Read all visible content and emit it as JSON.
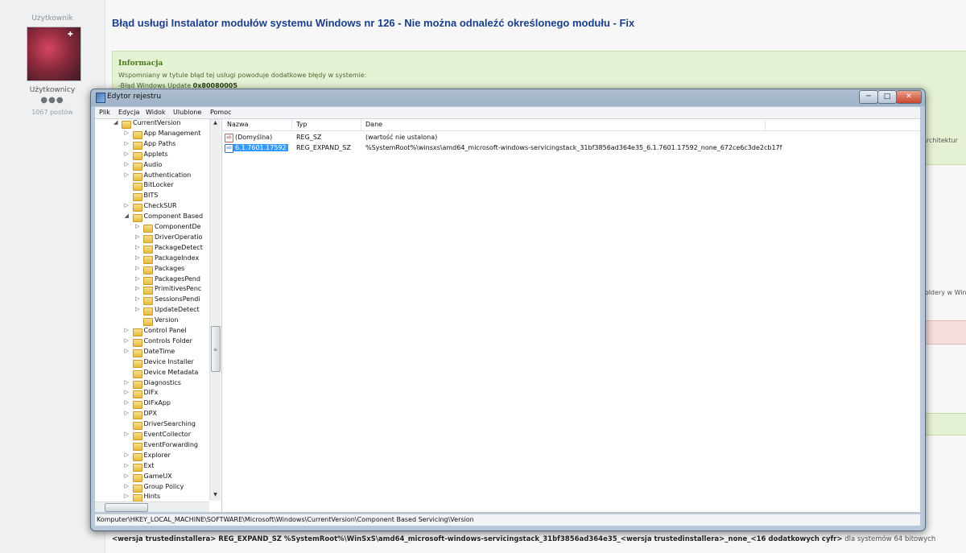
{
  "forum": {
    "sidebar": {
      "role_top": "Użytkownik",
      "username": "Użytkownicy",
      "rank_dots": "●●●",
      "post_count": "1067 postów"
    },
    "title": "Błąd usługi Instalator modułów systemu Windows nr 126 - Nie można odnaleźć określonego modułu - Fix",
    "info": {
      "heading": "Informacja",
      "text": "Wspomniany w tytule błąd tej usługi powoduje dodatkowe błędy w systemie:",
      "item_prefix": "-Błąd Windows Update ",
      "item_code": "0x80080005"
    },
    "snippets": {
      "right_1": "architektur",
      "right_2": "foldery w Win"
    },
    "bottom_line": {
      "part1": "<wersja trustedinstallera> REG_EXPAND_SZ %SystemRoot%\\WinSxS\\amd64_microsoft-windows-servicingstack_31bf3856ad364e35_<wersja trustedinstallera>_none_<16 dodatkowych cyfr>",
      "part2": " dla systemów 64 bitowych"
    }
  },
  "regedit": {
    "title": "Edytor rejestru",
    "buttons": {
      "minimize": "─",
      "maximize": "□",
      "close": "✕"
    },
    "menu": [
      "Plik",
      "Edycja",
      "Widok",
      "Ulubione",
      "Pomoc"
    ],
    "tree": [
      {
        "label": "CurrentVersion",
        "level": 0,
        "expander": "◢"
      },
      {
        "label": "App Management",
        "level": 1,
        "expander": "▷"
      },
      {
        "label": "App Paths",
        "level": 1,
        "expander": "▷"
      },
      {
        "label": "Applets",
        "level": 1,
        "expander": "▷"
      },
      {
        "label": "Audio",
        "level": 1,
        "expander": "▷"
      },
      {
        "label": "Authentication",
        "level": 1,
        "expander": "▷"
      },
      {
        "label": "BitLocker",
        "level": 1,
        "expander": ""
      },
      {
        "label": "BITS",
        "level": 1,
        "expander": ""
      },
      {
        "label": "CheckSUR",
        "level": 1,
        "expander": "▷"
      },
      {
        "label": "Component Based",
        "level": 1,
        "expander": "◢"
      },
      {
        "label": "ComponentDe",
        "level": 2,
        "expander": "▷"
      },
      {
        "label": "DriverOperatio",
        "level": 2,
        "expander": "▷"
      },
      {
        "label": "PackageDetect",
        "level": 2,
        "expander": "▷"
      },
      {
        "label": "PackageIndex",
        "level": 2,
        "expander": "▷"
      },
      {
        "label": "Packages",
        "level": 2,
        "expander": "▷"
      },
      {
        "label": "PackagesPend",
        "level": 2,
        "expander": "▷"
      },
      {
        "label": "PrimitivesPenc",
        "level": 2,
        "expander": "▷"
      },
      {
        "label": "SessionsPendi",
        "level": 2,
        "expander": "▷"
      },
      {
        "label": "UpdateDetect",
        "level": 2,
        "expander": "▷"
      },
      {
        "label": "Version",
        "level": 2,
        "expander": ""
      },
      {
        "label": "Control Panel",
        "level": 1,
        "expander": "▷"
      },
      {
        "label": "Controls Folder",
        "level": 1,
        "expander": "▷"
      },
      {
        "label": "DateTime",
        "level": 1,
        "expander": "▷"
      },
      {
        "label": "Device Installer",
        "level": 1,
        "expander": ""
      },
      {
        "label": "Device Metadata",
        "level": 1,
        "expander": ""
      },
      {
        "label": "Diagnostics",
        "level": 1,
        "expander": "▷"
      },
      {
        "label": "DIFx",
        "level": 1,
        "expander": "▷"
      },
      {
        "label": "DIFxApp",
        "level": 1,
        "expander": "▷"
      },
      {
        "label": "DPX",
        "level": 1,
        "expander": "▷"
      },
      {
        "label": "DriverSearching",
        "level": 1,
        "expander": ""
      },
      {
        "label": "EventCollector",
        "level": 1,
        "expander": "▷"
      },
      {
        "label": "EventForwarding",
        "level": 1,
        "expander": ""
      },
      {
        "label": "Explorer",
        "level": 1,
        "expander": "▷"
      },
      {
        "label": "Ext",
        "level": 1,
        "expander": "▷"
      },
      {
        "label": "GameUX",
        "level": 1,
        "expander": "▷"
      },
      {
        "label": "Group Policy",
        "level": 1,
        "expander": "▷"
      },
      {
        "label": "Hints",
        "level": 1,
        "expander": "▷"
      }
    ],
    "columns": {
      "name": "Nazwa",
      "type": "Typ",
      "data": "Dane"
    },
    "values": [
      {
        "icon": "ab",
        "name": "(Domyślna)",
        "type": "REG_SZ",
        "data": "(wartość nie ustalona)",
        "selected": false
      },
      {
        "icon": "ab",
        "name": "6.1.7601.17592",
        "type": "REG_EXPAND_SZ",
        "data": "%SystemRoot%\\winsxs\\amd64_microsoft-windows-servicingstack_31bf3856ad364e35_6.1.7601.17592_none_672ce6c3de2cb17f",
        "selected": true
      }
    ],
    "status_path": "Komputer\\HKEY_LOCAL_MACHINE\\SOFTWARE\\Microsoft\\Windows\\CurrentVersion\\Component Based Servicing\\Version",
    "scroll_glyphs": {
      "up": "▲",
      "down": "▼",
      "grip": "≡"
    }
  }
}
